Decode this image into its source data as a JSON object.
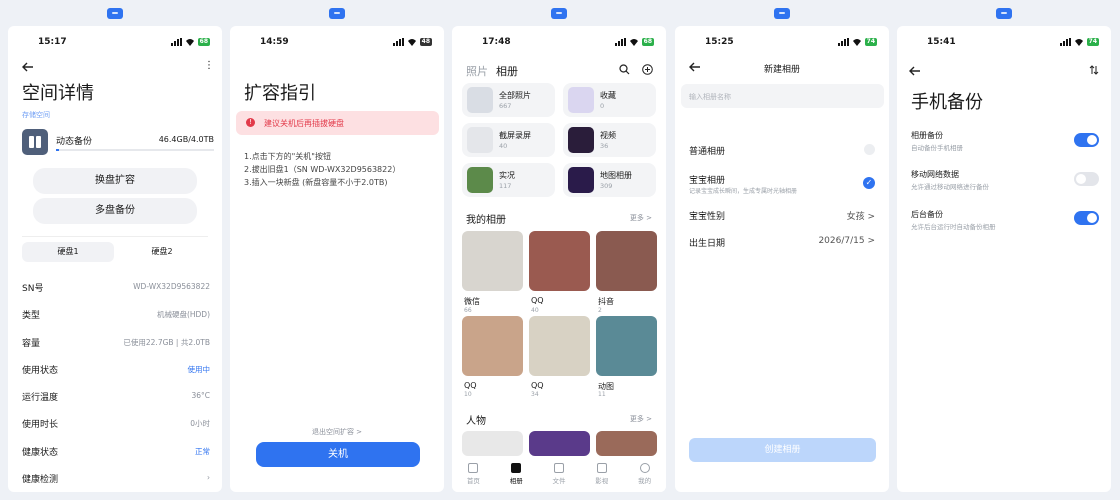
{
  "screen1": {
    "time": "15:17",
    "battery": "68",
    "title": "空间详情",
    "section": "存储空间",
    "backup_name": "动态备份",
    "backup_usage": "46.4GB/4.0TB",
    "btn_expand": "换盘扩容",
    "btn_multi": "多盘备份",
    "tab1": "硬盘1",
    "tab2": "硬盘2",
    "rows": [
      {
        "label": "SN号",
        "value": "WD-WX32D9563822"
      },
      {
        "label": "类型",
        "value": "机械硬盘(HDD)"
      },
      {
        "label": "容量",
        "value": "已使用22.7GB | 共2.0TB"
      },
      {
        "label": "使用状态",
        "value": "使用中"
      },
      {
        "label": "运行温度",
        "value": "36°C"
      },
      {
        "label": "使用时长",
        "value": "0小时"
      },
      {
        "label": "健康状态",
        "value": "正常"
      },
      {
        "label": "健康检测",
        "value": ""
      }
    ]
  },
  "screen2": {
    "time": "14:59",
    "battery": "48",
    "title": "扩容指引",
    "warning": "建议关机后再插拔硬盘",
    "step1": "1.点击下方的\"关机\"按钮",
    "step2": "2.拔出旧盘1（SN WD-WX32D9563822）",
    "step3": "3.插入一块新盘 (新盘容量不小于2.0TB)",
    "exit_link": "退出空间扩容 >",
    "shutdown": "关机"
  },
  "screen3": {
    "time": "17:48",
    "battery": "68",
    "tab_photos": "照片",
    "tab_albums": "相册",
    "cards": [
      {
        "name": "全部照片",
        "count": "667",
        "color": "#d9dde4"
      },
      {
        "name": "收藏",
        "count": "0",
        "color": "#dad6f0"
      },
      {
        "name": "截屏录屏",
        "count": "40",
        "color": "#e4e6ea"
      },
      {
        "name": "视频",
        "count": "36",
        "color": "#2a1d3a"
      },
      {
        "name": "实况",
        "count": "117",
        "color": "#5c8a4a"
      },
      {
        "name": "地图相册",
        "count": "309",
        "color": "#2a1b4a"
      }
    ],
    "my_albums": "我的相册",
    "more": "更多 >",
    "albums": [
      {
        "name": "微信",
        "count": "66",
        "color": "#d8d5cf"
      },
      {
        "name": "QQ",
        "count": "40",
        "color": "#9a5a50"
      },
      {
        "name": "抖音",
        "count": "2",
        "color": "#8a5a50"
      },
      {
        "name": "QQ",
        "count": "10",
        "color": "#c9a48a"
      },
      {
        "name": "QQ",
        "count": "34",
        "color": "#d8d2c4"
      },
      {
        "name": "动图",
        "count": "11",
        "color": "#5a8a96"
      }
    ],
    "people": "人物",
    "people_more": "更多 >",
    "tabbar": [
      "首页",
      "相册",
      "文件",
      "影视",
      "我的"
    ]
  },
  "screen4": {
    "time": "15:25",
    "battery": "74",
    "title": "新建相册",
    "input_placeholder": "输入相册名称",
    "normal_album": "普通相册",
    "baby_album": "宝宝相册",
    "baby_desc": "记录宝宝成长瞬间，生成专属时光轴相册",
    "gender_label": "宝宝性别",
    "gender_value": "女孩 >",
    "birthday_label": "出生日期",
    "birthday_value": "2026/7/15 >",
    "create_btn": "创建相册"
  },
  "screen5": {
    "time": "15:41",
    "battery": "74",
    "title": "手机备份",
    "items": [
      {
        "name": "相册备份",
        "desc": "自动备份手机相册",
        "on": true
      },
      {
        "name": "移动网络数据",
        "desc": "允许通过移动网络进行备份",
        "on": false
      },
      {
        "name": "后台备份",
        "desc": "允许后台运行时自动备份相册",
        "on": true
      }
    ]
  },
  "colors": {
    "accent": "#2f73f0",
    "warning_bg": "#fde0e2",
    "warning_text": "#e23a4a",
    "battery_green": "#2bb04a"
  }
}
